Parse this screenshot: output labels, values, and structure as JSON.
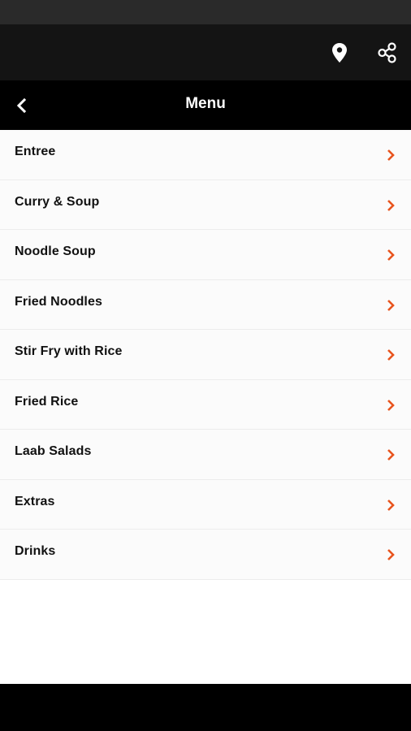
{
  "header": {
    "title": "Menu"
  },
  "icons": {
    "location": "location-pin-icon",
    "share": "share-icon",
    "back": "back-arrow-icon",
    "chevron": "chevron-right-icon"
  },
  "colors": {
    "accent": "#e8541e",
    "top_bar": "#141414",
    "title_bar": "#000000"
  },
  "menu": {
    "items": [
      {
        "label": "Entree"
      },
      {
        "label": "Curry & Soup"
      },
      {
        "label": "Noodle Soup"
      },
      {
        "label": "Fried Noodles"
      },
      {
        "label": "Stir Fry with Rice"
      },
      {
        "label": "Fried Rice"
      },
      {
        "label": "Laab Salads"
      },
      {
        "label": "Extras"
      },
      {
        "label": "Drinks"
      }
    ]
  }
}
